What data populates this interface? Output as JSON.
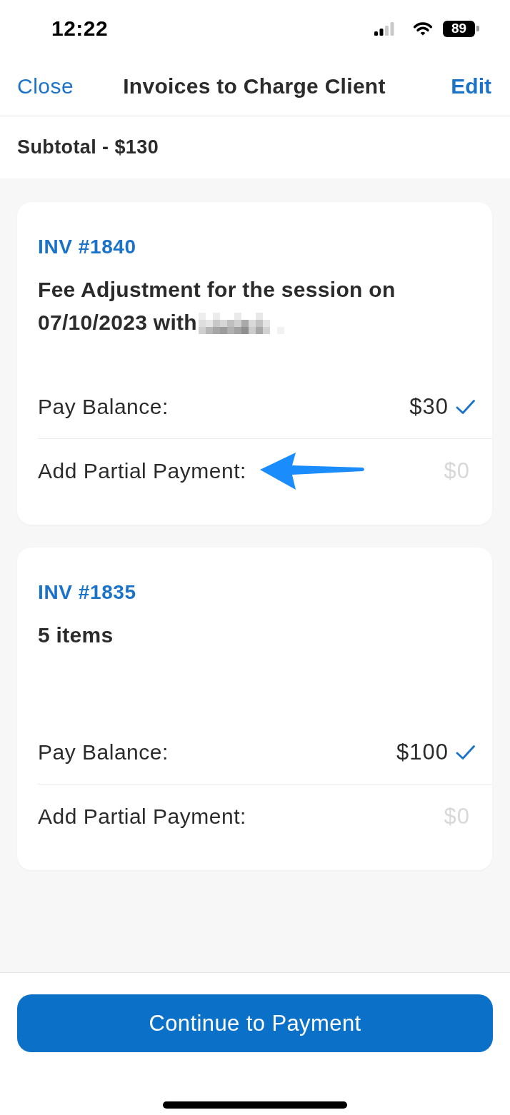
{
  "status_bar": {
    "time": "12:22",
    "battery": "89"
  },
  "nav_bar": {
    "left_button": "Close",
    "title": "Invoices to Charge Client",
    "right_button": "Edit"
  },
  "subtotal": "Subtotal - $130",
  "invoices": [
    {
      "number": "INV #1840",
      "description": "Fee Adjustment for the session on 07/10/2023 with",
      "name_redacted": true,
      "pay_balance": {
        "label": "Pay Balance:",
        "amount": "$30",
        "checked": true
      },
      "partial_payment": {
        "label": "Add Partial Payment:",
        "placeholder": "$0",
        "arrow": true
      }
    },
    {
      "number": "INV #1835",
      "description": "5 items",
      "name_redacted": false,
      "pay_balance": {
        "label": "Pay Balance:",
        "amount": "$100",
        "checked": true
      },
      "partial_payment": {
        "label": "Add Partial Payment:",
        "placeholder": "$0",
        "arrow": false
      }
    }
  ],
  "primary_button": "Continue to Payment"
}
